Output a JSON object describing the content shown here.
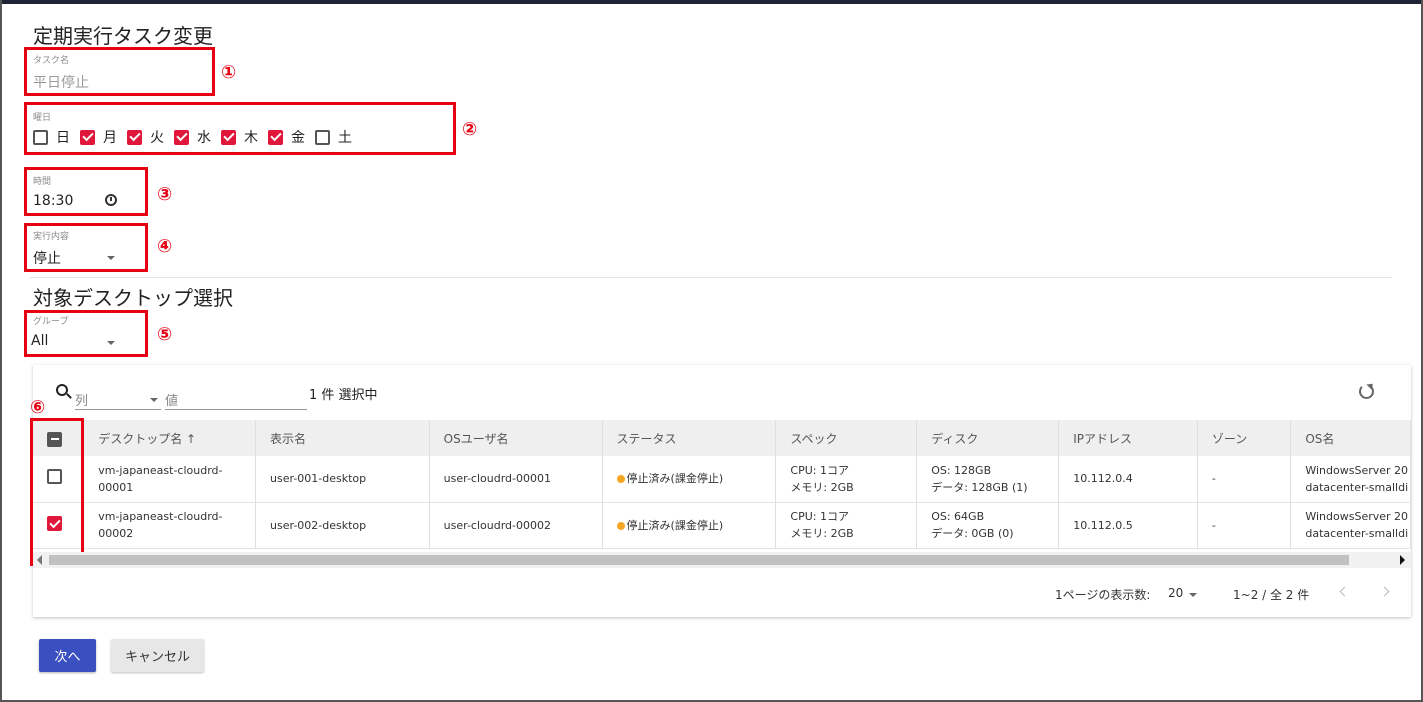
{
  "colors": {
    "accent": "#e0163b",
    "primary_button": "#3a4fc0",
    "annotation": "#e60012",
    "status_dot": "#f5a623"
  },
  "page_title": "定期実行タスク変更",
  "task_name": {
    "label": "タスク名",
    "value": "平日停止"
  },
  "weekdays": {
    "label": "曜日",
    "days": [
      {
        "label": "日",
        "checked": false
      },
      {
        "label": "月",
        "checked": true
      },
      {
        "label": "火",
        "checked": true
      },
      {
        "label": "水",
        "checked": true
      },
      {
        "label": "木",
        "checked": true
      },
      {
        "label": "金",
        "checked": true
      },
      {
        "label": "土",
        "checked": false
      }
    ]
  },
  "time": {
    "label": "時間",
    "value": "18:30",
    "icon": "clock-icon"
  },
  "action": {
    "label": "実行内容",
    "value": "停止"
  },
  "desktop_section_title": "対象デスクトップ選択",
  "group": {
    "label": "グループ",
    "value": "All"
  },
  "callouts": [
    "①",
    "②",
    "③",
    "④",
    "⑤",
    "⑥"
  ],
  "toolbar": {
    "column_placeholder": "列",
    "value_placeholder": "値",
    "selection_count": "1 件 選択中",
    "refresh_icon": "refresh-icon"
  },
  "table": {
    "headers": [
      "デスクトップ名 ↑",
      "表示名",
      "OSユーザ名",
      "ステータス",
      "スペック",
      "ディスク",
      "IPアドレス",
      "ゾーン",
      "OS名"
    ],
    "rows": [
      {
        "checked": false,
        "desktop_name": [
          "vm-japaneast-cloudrd-",
          "00001"
        ],
        "display_name": "user-001-desktop",
        "os_user": "user-cloudrd-00001",
        "status": "停止済み(課金停止)",
        "spec": [
          "CPU: 1コア",
          "メモリ: 2GB"
        ],
        "disk": [
          "OS: 128GB",
          "データ: 128GB (1)"
        ],
        "ip": "10.112.0.4",
        "zone": "-",
        "os": [
          "WindowsServer 20",
          "datacenter-smalldi"
        ]
      },
      {
        "checked": true,
        "desktop_name": [
          "vm-japaneast-cloudrd-",
          "00002"
        ],
        "display_name": "user-002-desktop",
        "os_user": "user-cloudrd-00002",
        "status": "停止済み(課金停止)",
        "spec": [
          "CPU: 1コア",
          "メモリ: 2GB"
        ],
        "disk": [
          "OS: 64GB",
          "データ: 0GB (0)"
        ],
        "ip": "10.112.0.5",
        "zone": "-",
        "os": [
          "WindowsServer 20",
          "datacenter-smalldi"
        ]
      }
    ]
  },
  "pagination": {
    "rows_per_page_label": "1ページの表示数:",
    "rows_per_page_value": "20",
    "range": "1~2 / 全 2 件"
  },
  "buttons": {
    "next": "次へ",
    "cancel": "キャンセル"
  }
}
